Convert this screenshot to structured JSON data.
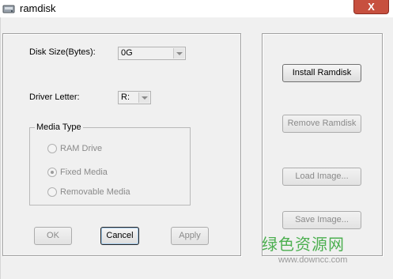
{
  "window": {
    "title": "ramdisk",
    "close_glyph": "X"
  },
  "icons": {
    "app": "disk-app-icon",
    "close": "close-icon"
  },
  "form": {
    "disk_size_label": "Disk Size(Bytes):",
    "disk_size_value": "0G",
    "driver_letter_label": "Driver Letter:",
    "driver_letter_value": "R:",
    "media_type_title": "Media Type",
    "media_options": [
      {
        "label": "RAM Drive",
        "checked": false
      },
      {
        "label": "Fixed Media",
        "checked": true
      },
      {
        "label": "Removable Media",
        "checked": false
      }
    ]
  },
  "buttons": {
    "ok": "OK",
    "cancel": "Cancel",
    "apply": "Apply",
    "install": "Install Ramdisk",
    "remove": "Remove Ramdisk",
    "load": "Load Image...",
    "save": "Save Image..."
  },
  "watermark": {
    "text": "绿色资源网",
    "url": "www.downcc.com"
  },
  "colors": {
    "close_button": "#c7503f",
    "watermark": "#4caf50"
  }
}
